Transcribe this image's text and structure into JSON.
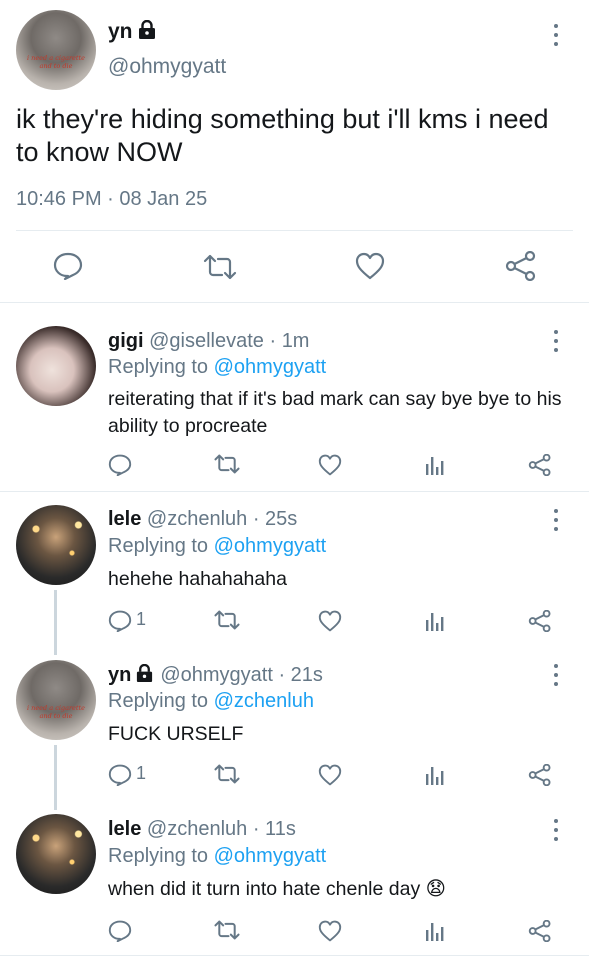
{
  "main_tweet": {
    "name": "yn",
    "handle": "@ohmygyatt",
    "avatar_caption": "i need a cigarette and to die",
    "text": "ik they're hiding something but i'll kms i need to know NOW",
    "timestamp": "10:46 PM · 08 Jan 25"
  },
  "replies": [
    {
      "name": "gigi",
      "handle_meta": "@gisellevate · 1m",
      "replying_prefix": "Replying to ",
      "replying_to": "@ohmygyatt",
      "text": "reiterating that if it's bad mark can say bye bye to his ability to procreate",
      "reply_count": ""
    },
    {
      "name": "lele",
      "handle_meta": "@zchenluh · 25s",
      "replying_prefix": "Replying to ",
      "replying_to": "@ohmygyatt",
      "text": "hehehe hahahahaha",
      "reply_count": "1"
    },
    {
      "name": "yn",
      "handle_meta": "@ohmygyatt · 21s",
      "replying_prefix": "Replying to ",
      "replying_to": "@zchenluh",
      "text": "FUCK URSELF",
      "reply_count": "1",
      "avatar_caption": "i need a cigarette and to die"
    },
    {
      "name": "lele",
      "handle_meta": "@zchenluh · 11s",
      "replying_prefix": "Replying to ",
      "replying_to": "@ohmygyatt",
      "text": "when did it turn into hate chenle day 😧",
      "reply_count": ""
    }
  ],
  "colors": {
    "accent": "#1da1f2",
    "secondary_text": "#657786",
    "divider": "#e6ecf0",
    "thread_line": "#ccd6dd"
  }
}
